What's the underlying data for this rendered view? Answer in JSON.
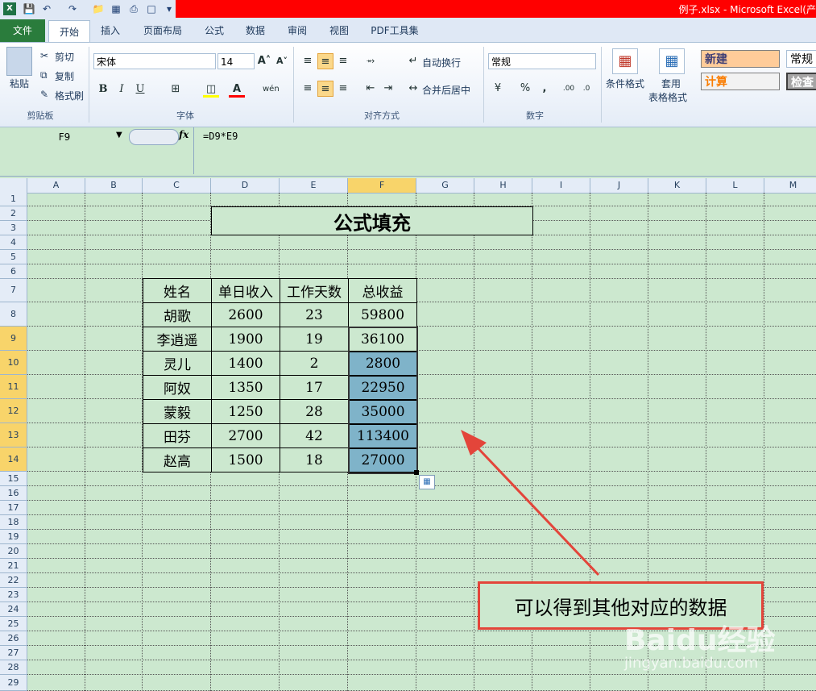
{
  "title": {
    "text": "例子.xlsx - Microsoft Excel(产"
  },
  "tabs": {
    "file": "文件",
    "home": "开始",
    "insert": "插入",
    "layout": "页面布局",
    "formula": "公式",
    "data": "数据",
    "review": "审阅",
    "view": "视图",
    "pdf": "PDF工具集"
  },
  "ribbon": {
    "paste": "粘贴",
    "cut": "剪切",
    "copy": "复制",
    "format_painter": "格式刷",
    "clipboard_label": "剪贴板",
    "font_name": "宋体",
    "font_size": "14",
    "bold": "B",
    "italic": "I",
    "underline": "U",
    "font_label": "字体",
    "wrap_text": "自动换行",
    "merge_center": "合并后居中",
    "align_label": "对齐方式",
    "number_format": "常规",
    "percent": "%",
    "comma": ",",
    "number_label": "数字",
    "cond_format": "条件格式",
    "table_format_1": "套用",
    "table_format_2": "表格格式",
    "style_new": "新建",
    "style_normal": "常规",
    "style_calc": "计算",
    "style_check": "检查"
  },
  "formula_bar": {
    "name_box": "F9",
    "fx": "fx",
    "formula": "=D9*E9"
  },
  "columns": [
    "A",
    "B",
    "C",
    "D",
    "E",
    "F",
    "G",
    "H",
    "I",
    "J",
    "K",
    "L",
    "M"
  ],
  "rows": [
    "1",
    "2",
    "3",
    "4",
    "5",
    "6",
    "7",
    "8",
    "9",
    "10",
    "11",
    "12",
    "13",
    "14",
    "15",
    "16",
    "17",
    "18",
    "19",
    "20",
    "21",
    "22",
    "23",
    "24",
    "25",
    "26",
    "27",
    "28",
    "29"
  ],
  "sheet": {
    "title": "公式填充",
    "headers": [
      "姓名",
      "单日收入",
      "工作天数",
      "总收益"
    ],
    "data": [
      [
        "胡歌",
        "2600",
        "23",
        "59800"
      ],
      [
        "李逍遥",
        "1900",
        "19",
        "36100"
      ],
      [
        "灵儿",
        "1400",
        "2",
        "2800"
      ],
      [
        "阿奴",
        "1350",
        "17",
        "22950"
      ],
      [
        "蒙毅",
        "1250",
        "28",
        "35000"
      ],
      [
        "田芬",
        "2700",
        "42",
        "113400"
      ],
      [
        "赵高",
        "1500",
        "18",
        "27000"
      ]
    ]
  },
  "annotation": "可以得到其他对应的数据",
  "watermark": {
    "brand": "Baidu经验",
    "url": "jingyan.baidu.com"
  }
}
